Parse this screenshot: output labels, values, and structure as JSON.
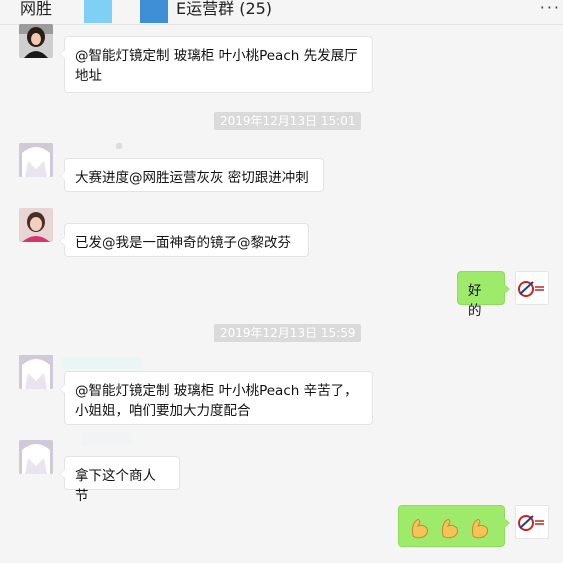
{
  "header": {
    "title_left": "网胜",
    "title_right": "E运营群 (25)",
    "more_glyph": "···"
  },
  "messages": [
    {
      "text_lines": [
        "@智能灯镜定制 玻璃柜 叶小桃Peach 先发展厅",
        "地址"
      ]
    },
    {
      "text_lines": [
        "大赛进度@网胜运营灰灰 密切跟进冲刺"
      ]
    },
    {
      "text_lines": [
        "已发@我是一面神奇的镜子@黎改芬"
      ]
    },
    {
      "text_lines": [
        "好的"
      ]
    },
    {
      "text_lines": [
        "@智能灯镜定制 玻璃柜 叶小桃Peach 辛苦了，",
        "小姐姐，咱们要加大力度配合"
      ]
    },
    {
      "text_lines": [
        "拿下这个商人节"
      ]
    },
    {
      "emojis": [
        "flexed-biceps",
        "flexed-biceps",
        "flexed-biceps"
      ]
    }
  ],
  "timestamps": [
    "2019年12月13日 15:01",
    "2019年12月13日 15:59"
  ],
  "colors": {
    "background": "#f5f5f5",
    "outgoing_bubble": "#9eea6a",
    "incoming_bubble": "#ffffff",
    "timestamp_bg": "#dadada"
  }
}
